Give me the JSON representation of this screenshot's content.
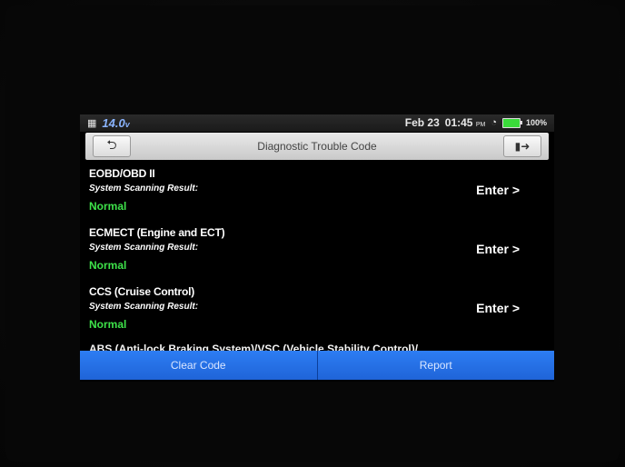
{
  "status_bar": {
    "voltage_value": "14.0",
    "voltage_unit": "v",
    "date": "Feb 23",
    "time": "01:45",
    "ampm": "PM",
    "battery_pct": "100%"
  },
  "title_bar": {
    "title": "Diagnostic Trouble Code"
  },
  "systems": [
    {
      "name": "EOBD/OBD II",
      "subtitle": "System Scanning Result:",
      "status": "Normal",
      "action": "Enter >"
    },
    {
      "name": "ECMECT (Engine and ECT)",
      "subtitle": "System Scanning Result:",
      "status": "Normal",
      "action": "Enter >"
    },
    {
      "name": "CCS (Cruise Control)",
      "subtitle": "System Scanning Result:",
      "status": "Normal",
      "action": "Enter >"
    }
  ],
  "partial_item": "ABS (Anti-lock Braking System)/VSC (Vehicle Stability Control)/",
  "bottom_bar": {
    "clear_code": "Clear Code",
    "report": "Report"
  },
  "colors": {
    "status_normal": "#3ee24a",
    "bottom_bar": "#2d7df3",
    "voltage": "#8ab4ff"
  }
}
